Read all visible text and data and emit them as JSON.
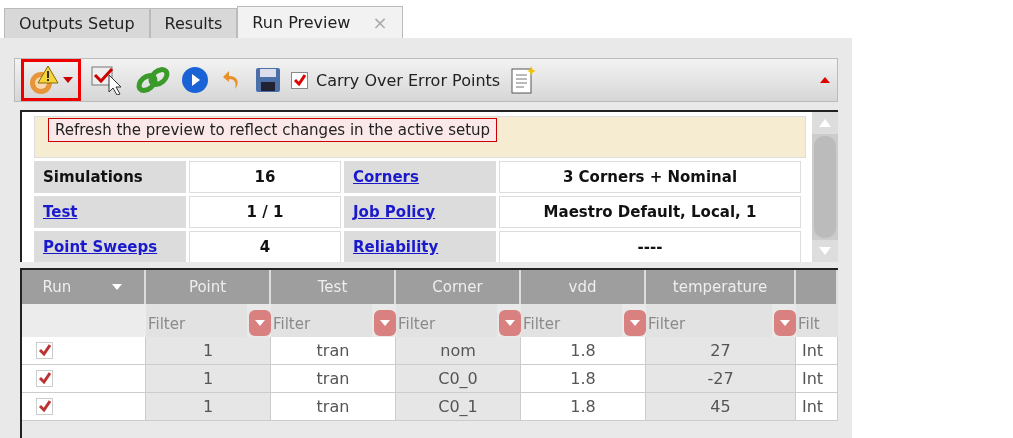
{
  "tabs": [
    {
      "label": "Outputs Setup",
      "selected": false
    },
    {
      "label": "Results",
      "selected": false
    },
    {
      "label": "Run Preview",
      "selected": true,
      "close": "×"
    }
  ],
  "toolbar": {
    "refresh_highlighted": true,
    "carry_over": {
      "label": "Carry Over Error Points",
      "checked": true
    }
  },
  "tooltip": "Refresh the preview to reflect changes in the active setup",
  "summary": {
    "rows": [
      [
        {
          "text": "Simulations",
          "kind": "label"
        },
        {
          "text": "16",
          "kind": "value"
        },
        {
          "text": "Corners",
          "kind": "link"
        },
        {
          "text": "3 Corners + Nominal",
          "kind": "value"
        }
      ],
      [
        {
          "text": "Test",
          "kind": "link"
        },
        {
          "text": "1 / 1",
          "kind": "value"
        },
        {
          "text": "Job Policy",
          "kind": "link"
        },
        {
          "text": "Maestro Default, Local, 1",
          "kind": "value"
        }
      ],
      [
        {
          "text": "Point Sweeps",
          "kind": "link"
        },
        {
          "text": "4",
          "kind": "value"
        },
        {
          "text": "Reliability",
          "kind": "link"
        },
        {
          "text": "----",
          "kind": "value"
        }
      ]
    ]
  },
  "table": {
    "run_column": {
      "label": "Run"
    },
    "columns": [
      {
        "label": "Point"
      },
      {
        "label": "Test"
      },
      {
        "label": "Corner"
      },
      {
        "label": "vdd"
      },
      {
        "label": "temperature"
      },
      {}
    ],
    "filters": [
      {
        "placeholder": "Filter"
      },
      {
        "placeholder": "Filter"
      },
      {
        "placeholder": "Filter"
      },
      {
        "placeholder": "Filter"
      },
      {
        "placeholder": "Filter"
      },
      {
        "placeholder": "Filt"
      }
    ],
    "rows": [
      {
        "run": true,
        "cells": [
          "1",
          "tran",
          "nom",
          "1.8",
          "27",
          "Int"
        ]
      },
      {
        "run": true,
        "cells": [
          "1",
          "tran",
          "C0_0",
          "1.8",
          "-27",
          "Int"
        ]
      },
      {
        "run": true,
        "cells": [
          "1",
          "tran",
          "C0_1",
          "1.8",
          "45",
          "Int"
        ]
      }
    ]
  }
}
